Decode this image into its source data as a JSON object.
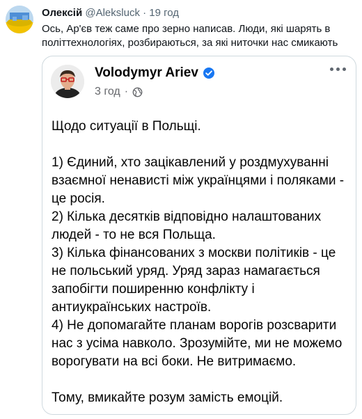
{
  "tweet": {
    "author_name": "Олексій",
    "handle": "@Aleksluck",
    "separator": "·",
    "time": "19 год",
    "text": "Ось, Ар'єв теж саме про зерно написав. Люди, які шарять в політтехнологіях, розбираються, за які ниточки нас смикають"
  },
  "embedded_post": {
    "author": "Volodymyr Ariev",
    "verified_icon": "verified-badge-icon",
    "time": "3 год",
    "separator": "·",
    "audience_icon": "globe-icon",
    "menu_icon": "more-options-icon",
    "paragraphs": [
      "Щодо ситуації в Польщі.",
      "",
      "1) Єдиний, хто зацікавлений у роздмухуванні взаємної ненависті між українцями і поляками - це росія.",
      "2) Кілька десятків відповідно налаштованих людей - то не вся Польща.",
      "3) Кілька фінансованих з москви політиків - це не польський уряд. Уряд зараз намагається запобігти поширенню конфлікту і антиукраїнських настроїв.",
      "4) Не допомагайте планам ворогів розсварити нас з усіма навколо. Зрозумійте, ми не можемо ворогувати на всі боки. Не витримаємо.",
      "",
      "Тому, вмикайте розум замість емоцій."
    ]
  },
  "colors": {
    "accent_blue": "#1877f2",
    "secondary_text": "#65676b",
    "border": "#cfd9de"
  }
}
